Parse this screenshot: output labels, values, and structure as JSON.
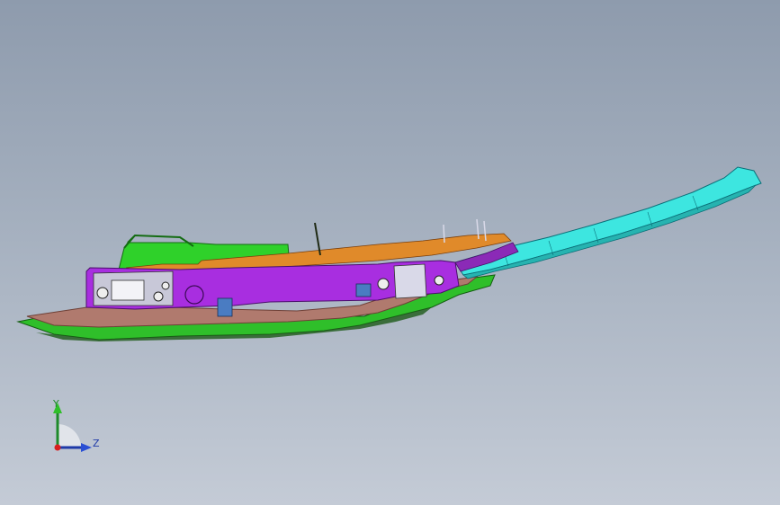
{
  "viewport": {
    "background_top": "#8e9bad",
    "background_bottom": "#c4cbd6"
  },
  "model": {
    "part_colors": {
      "base": "#2fbf2a",
      "tray": "#b07a6e",
      "frame": "#a82ee0",
      "rail": "#3de6e0",
      "upper": "#2fd12a",
      "bracket": "#d9d9e8",
      "wiring": "#e08a2a"
    }
  },
  "triad": {
    "y_label": "Y",
    "z_label": "Z",
    "y_color": "#1e8a2a",
    "z_color": "#1f3aa8",
    "origin_color": "#d81e1e"
  }
}
